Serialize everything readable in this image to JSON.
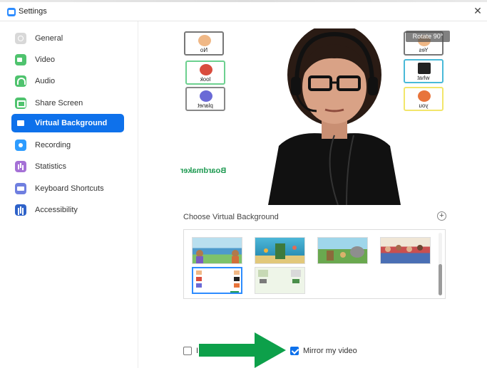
{
  "window": {
    "title": "Settings",
    "close_glyph": "✕"
  },
  "sidebar": {
    "items": [
      {
        "label": "General",
        "icon": "gear-icon",
        "active": false
      },
      {
        "label": "Video",
        "icon": "video-camera-icon",
        "active": false
      },
      {
        "label": "Audio",
        "icon": "headphones-icon",
        "active": false
      },
      {
        "label": "Share Screen",
        "icon": "share-screen-icon",
        "active": false
      },
      {
        "label": "Virtual Background",
        "icon": "virtual-background-icon",
        "active": true
      },
      {
        "label": "Recording",
        "icon": "record-icon",
        "active": false
      },
      {
        "label": "Statistics",
        "icon": "bar-chart-icon",
        "active": false
      },
      {
        "label": "Keyboard Shortcuts",
        "icon": "keyboard-icon",
        "active": false
      },
      {
        "label": "Accessibility",
        "icon": "accessibility-icon",
        "active": false
      }
    ]
  },
  "preview": {
    "rotate_label": "Rotate 90°",
    "watermark": "Boardmaker",
    "cards": [
      "No",
      "look",
      "planet",
      "Yes",
      "what",
      "you"
    ]
  },
  "virtual_background": {
    "heading": "Choose Virtual Background",
    "add_glyph": "+",
    "thumbnails": [
      "lake-cartoon",
      "underwater-cartoon",
      "savanna-cartoon",
      "crowd-cartoon",
      "board-slide",
      "classroom-slide"
    ],
    "selected_index": 4
  },
  "options": {
    "left_checkbox_label": "I",
    "left_checked": false,
    "mirror_label": "Mirror my video",
    "mirror_checked": true
  },
  "colors": {
    "accent": "#0e71eb",
    "arrow": "#0da04a"
  }
}
